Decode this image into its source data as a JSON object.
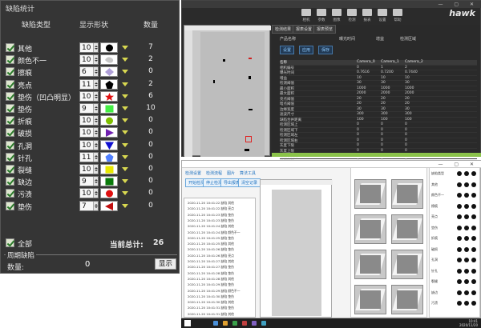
{
  "panel": {
    "title": "缺陷统计",
    "headers": {
      "type": "缺陷类型",
      "shape": "显示形状",
      "count": "数量"
    },
    "rows": [
      {
        "name": "其他",
        "size": "10",
        "shape": "circle",
        "color": "#000000",
        "count": "7"
      },
      {
        "name": "颜色不一",
        "size": "10",
        "shape": "blob",
        "color": "#c8c8c8",
        "count": "2"
      },
      {
        "name": "擦痕",
        "size": "6",
        "shape": "diamond",
        "color": "#b0a0d8",
        "count": "0"
      },
      {
        "name": "亮点",
        "size": "11",
        "shape": "pentagon",
        "color": "#000000",
        "count": "2"
      },
      {
        "name": "垫伤（凹凸明显）",
        "size": "10",
        "shape": "star",
        "color": "#e01010",
        "count": "6"
      },
      {
        "name": "垫伤",
        "size": "9",
        "shape": "square",
        "color": "#44ee44",
        "count": "10"
      },
      {
        "name": "折痕",
        "size": "10",
        "shape": "circle",
        "color": "#7fbf00",
        "count": "0"
      },
      {
        "name": "破损",
        "size": "10",
        "shape": "triangle-right",
        "color": "#7020b0",
        "count": "0"
      },
      {
        "name": "孔洞",
        "size": "10",
        "shape": "triangle-down",
        "color": "#1010d0",
        "count": "0"
      },
      {
        "name": "针孔",
        "size": "11",
        "shape": "pentagon",
        "color": "#5080ff",
        "count": "0"
      },
      {
        "name": "裂缝",
        "size": "10",
        "shape": "square",
        "color": "#e8e800",
        "count": "0"
      },
      {
        "name": "缺边",
        "size": "9",
        "shape": "square",
        "color": "#0a7a0a",
        "count": "0"
      },
      {
        "name": "污渍",
        "size": "10",
        "shape": "circle",
        "color": "#e01010",
        "count": "0"
      },
      {
        "name": "垫伤",
        "size": "7",
        "shape": "triangle-left",
        "color": "#c01010",
        "count": "0"
      }
    ],
    "all_label": "全部",
    "total_label": "当前总计:",
    "total_value": "26",
    "cycle_title": "周期缺陷",
    "cycle_qty_label": "数量:",
    "cycle_qty_value": "0",
    "show_button": "显示"
  },
  "win_top": {
    "title": "hawkvis",
    "brand": "hawk",
    "toolbar": [
      "相机",
      "参数",
      "图像",
      "检测",
      "报表",
      "设置",
      "帮助"
    ],
    "tabs": [
      "检测结果",
      "报表设置",
      "报表预览"
    ],
    "buttons": [
      "设置",
      "应用",
      "保存"
    ],
    "labels": [
      "产品名称",
      "曝光时间",
      "增益",
      "检测区域"
    ],
    "table_headers": [
      "名称",
      "Camera_0",
      "Camera_1",
      "Camera_2"
    ],
    "table_rows": [
      [
        "相机编号",
        "0",
        "1",
        "2"
      ],
      [
        "曝光时间",
        "0.7616",
        "0.7200",
        "0.7440"
      ],
      [
        "增益",
        "10",
        "10",
        "10"
      ],
      [
        "检测阈值",
        "30",
        "30",
        "30"
      ],
      [
        "最小面积",
        "1000",
        "1000",
        "1000"
      ],
      [
        "最大面积",
        "2000",
        "2000",
        "2000"
      ],
      [
        "亮点阈值",
        "20",
        "20",
        "20"
      ],
      [
        "暗点阈值",
        "20",
        "20",
        "20"
      ],
      [
        "边缘宽度",
        "30",
        "30",
        "30"
      ],
      [
        "滤波尺寸",
        "300",
        "300",
        "300"
      ],
      [
        "缺陷合并距离",
        "100",
        "100",
        "100"
      ],
      [
        "检测区域上",
        "0",
        "0",
        "0"
      ],
      [
        "检测区域下",
        "0",
        "0",
        "0"
      ],
      [
        "检测区域左",
        "0",
        "0",
        "0"
      ],
      [
        "检测区域右",
        "0",
        "0",
        "0"
      ],
      [
        "灰度下限",
        "0",
        "0",
        "0"
      ],
      [
        "灰度上限",
        "0",
        "0",
        "0"
      ],
      [
        "过滤长宽比",
        "0",
        "0",
        "0"
      ],
      [
        "周期缺陷",
        "0",
        "0",
        "0"
      ],
      [
        "启用",
        "0",
        "0",
        "0"
      ]
    ]
  },
  "win_bot": {
    "tabs": [
      "检测设置",
      "检测流程",
      "图片",
      "算法工具"
    ],
    "buttons": [
      "开始检测",
      "停止检测",
      "导出报表",
      "清空记录"
    ],
    "log_rows": [
      "2020-11-20 10:41:22 缺陷 其他",
      "2020-11-20 10:41:22 缺陷 亮点",
      "2020-11-20 10:41:23 缺陷 垫伤",
      "2020-11-20 10:41:23 缺陷 垫伤",
      "2020-11-20 10:41:24 缺陷 其他",
      "2020-11-20 10:41:24 缺陷 颜色不一",
      "2020-11-20 10:41:25 缺陷 垫伤",
      "2020-11-20 10:41:25 缺陷 其他",
      "2020-11-20 10:41:26 缺陷 垫伤",
      "2020-11-20 10:41:26 缺陷 亮点",
      "2020-11-20 10:41:27 缺陷 其他",
      "2020-11-20 10:41:27 缺陷 垫伤",
      "2020-11-20 10:41:28 缺陷 垫伤",
      "2020-11-20 10:41:28 缺陷 其他",
      "2020-11-20 10:41:29 缺陷 垫伤",
      "2020-11-20 10:41:29 缺陷 颜色不一",
      "2020-11-20 10:41:30 缺陷 垫伤",
      "2020-11-20 10:41:30 缺陷 其他",
      "2020-11-20 10:41:31 缺陷 垫伤",
      "2020-11-20 10:41:31 缺陷 其他"
    ],
    "stat_labels": [
      "缺陷类型",
      "其他",
      "颜色不一",
      "擦痕",
      "亮点",
      "垫伤",
      "折痕",
      "破损",
      "孔洞",
      "针孔",
      "裂缝",
      "缺边",
      "污渍"
    ]
  },
  "taskbar": {
    "time": "10:41",
    "date": "2020/11/20"
  }
}
